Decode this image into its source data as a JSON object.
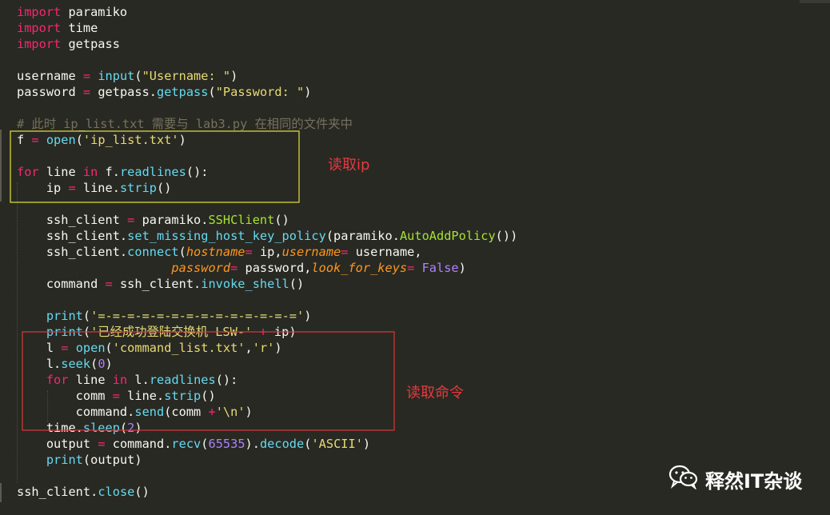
{
  "editor": {
    "lines": [
      [
        [
          "kw",
          "import"
        ],
        [
          "",
          "paramiko"
        ]
      ],
      [
        [
          "kw",
          "import"
        ],
        [
          "",
          "time"
        ]
      ],
      [
        [
          "kw",
          "import"
        ],
        [
          "",
          "getpass"
        ]
      ],
      [],
      [
        [
          "",
          "username "
        ],
        [
          "kw",
          "="
        ],
        [
          "",
          ""
        ],
        [
          "fn",
          "input"
        ],
        [
          "",
          "("
        ],
        [
          "str",
          "\"Username: \""
        ],
        [
          "",
          ")"
        ]
      ],
      [
        [
          "",
          "password "
        ],
        [
          "kw",
          "="
        ],
        [
          "",
          "getpass."
        ],
        [
          "fn",
          "getpass"
        ],
        [
          "",
          "("
        ],
        [
          "str",
          "\"Password: \""
        ],
        [
          "",
          ")"
        ]
      ],
      [],
      [
        [
          "comment",
          "# 此时 ip_list.txt 需要与 lab3.py 在相同的文件夹中"
        ]
      ],
      [
        [
          "",
          "f "
        ],
        [
          "kw",
          "="
        ],
        [
          "",
          ""
        ],
        [
          "fn",
          "open"
        ],
        [
          "",
          "("
        ],
        [
          "str",
          "'ip_list.txt'"
        ],
        [
          "",
          ")"
        ]
      ],
      [],
      [
        [
          "kw",
          "for"
        ],
        [
          "",
          "line "
        ],
        [
          "kw",
          "in"
        ],
        [
          "",
          "f."
        ],
        [
          "fn",
          "readlines"
        ],
        [
          "",
          "():"
        ]
      ],
      [
        [
          "",
          "    ip "
        ],
        [
          "kw",
          "="
        ],
        [
          "",
          "line."
        ],
        [
          "fn",
          "strip"
        ],
        [
          "",
          "()"
        ]
      ],
      [],
      [
        [
          "",
          "    ssh_client "
        ],
        [
          "kw",
          "="
        ],
        [
          "",
          "paramiko."
        ],
        [
          "cls",
          "SSHClient"
        ],
        [
          "",
          "()"
        ]
      ],
      [
        [
          "",
          "    ssh_client."
        ],
        [
          "fn",
          "set_missing_host_key_policy"
        ],
        [
          "",
          "(paramiko."
        ],
        [
          "cls",
          "AutoAddPolicy"
        ],
        [
          "",
          "())"
        ]
      ],
      [
        [
          "",
          "    ssh_client."
        ],
        [
          "fn",
          "connect"
        ],
        [
          "",
          "("
        ],
        [
          "param",
          "hostname"
        ],
        [
          "kw",
          "="
        ],
        [
          "",
          "ip,"
        ],
        [
          "param",
          "username"
        ],
        [
          "kw",
          "="
        ],
        [
          "",
          "username,"
        ]
      ],
      [
        [
          "",
          "                     "
        ],
        [
          "param",
          "password"
        ],
        [
          "kw",
          "="
        ],
        [
          "",
          "password,"
        ],
        [
          "param",
          "look_for_keys"
        ],
        [
          "kw",
          "="
        ],
        [
          "num",
          "False"
        ],
        [
          "",
          ")"
        ]
      ],
      [
        [
          "",
          "    command "
        ],
        [
          "kw",
          "="
        ],
        [
          "",
          "ssh_client."
        ],
        [
          "fn",
          "invoke_shell"
        ],
        [
          "",
          "()"
        ]
      ],
      [],
      [
        [
          "",
          "    "
        ],
        [
          "fn",
          "print"
        ],
        [
          "",
          "("
        ],
        [
          "str",
          "'=-=-=-=-=-=-=-=-=-=-=-=-=-='"
        ],
        [
          "",
          ")"
        ]
      ],
      [
        [
          "",
          "    "
        ],
        [
          "fn",
          "print"
        ],
        [
          "",
          "("
        ],
        [
          "str",
          "'已经成功登陆交换机 LSW-'"
        ],
        [
          "kw",
          " +"
        ],
        [
          "",
          " ip)"
        ]
      ],
      [
        [
          "",
          "    l "
        ],
        [
          "kw",
          "="
        ],
        [
          "",
          ""
        ],
        [
          "fn",
          "open"
        ],
        [
          "",
          "("
        ],
        [
          "str",
          "'command_list.txt'"
        ],
        [
          "",
          ","
        ],
        [
          "str",
          "'r'"
        ],
        [
          "",
          ")"
        ]
      ],
      [
        [
          "",
          "    l."
        ],
        [
          "fn",
          "seek"
        ],
        [
          "",
          "("
        ],
        [
          "num",
          "0"
        ],
        [
          "",
          ")"
        ]
      ],
      [
        [
          "",
          "    "
        ],
        [
          "kw",
          "for"
        ],
        [
          "",
          "line "
        ],
        [
          "kw",
          "in"
        ],
        [
          "",
          "l."
        ],
        [
          "fn",
          "readlines"
        ],
        [
          "",
          "():"
        ]
      ],
      [
        [
          "",
          "        comm "
        ],
        [
          "kw",
          "="
        ],
        [
          "",
          "line."
        ],
        [
          "fn",
          "strip"
        ],
        [
          "",
          "()"
        ]
      ],
      [
        [
          "",
          "        command."
        ],
        [
          "fn",
          "send"
        ],
        [
          "",
          "(comm "
        ],
        [
          "kw",
          "+"
        ],
        [
          "",
          ""
        ],
        [
          "str",
          "'\\n'"
        ],
        [
          "",
          ")"
        ]
      ],
      [
        [
          "",
          "    time."
        ],
        [
          "fn",
          "sleep"
        ],
        [
          "",
          "("
        ],
        [
          "num",
          "2"
        ],
        [
          "",
          ")"
        ]
      ],
      [
        [
          "",
          "    output "
        ],
        [
          "kw",
          "="
        ],
        [
          "",
          "command."
        ],
        [
          "fn",
          "recv"
        ],
        [
          "",
          "("
        ],
        [
          "num",
          "65535"
        ],
        [
          "",
          ")."
        ],
        [
          "fn",
          "decode"
        ],
        [
          "",
          "("
        ],
        [
          "str",
          "'ASCII'"
        ],
        [
          "",
          ")"
        ]
      ],
      [
        [
          "",
          "    "
        ],
        [
          "fn",
          "print"
        ],
        [
          "",
          "(output)"
        ]
      ],
      [],
      [
        [
          "",
          "ssh_client."
        ],
        [
          "fn",
          "close"
        ],
        [
          "",
          "()"
        ]
      ]
    ]
  },
  "annotations": {
    "read_ip": "读取ip",
    "read_commands": "读取命令"
  },
  "watermark": {
    "text": "释然IT杂谈",
    "icon": "wechat-icon"
  },
  "colors": {
    "background": "#282923",
    "keyword": "#f92672",
    "function": "#66d9ef",
    "string": "#e6db74",
    "number": "#ae81ff",
    "annotation_red": "#e8383d",
    "box_yellow": "#e6e23a"
  }
}
